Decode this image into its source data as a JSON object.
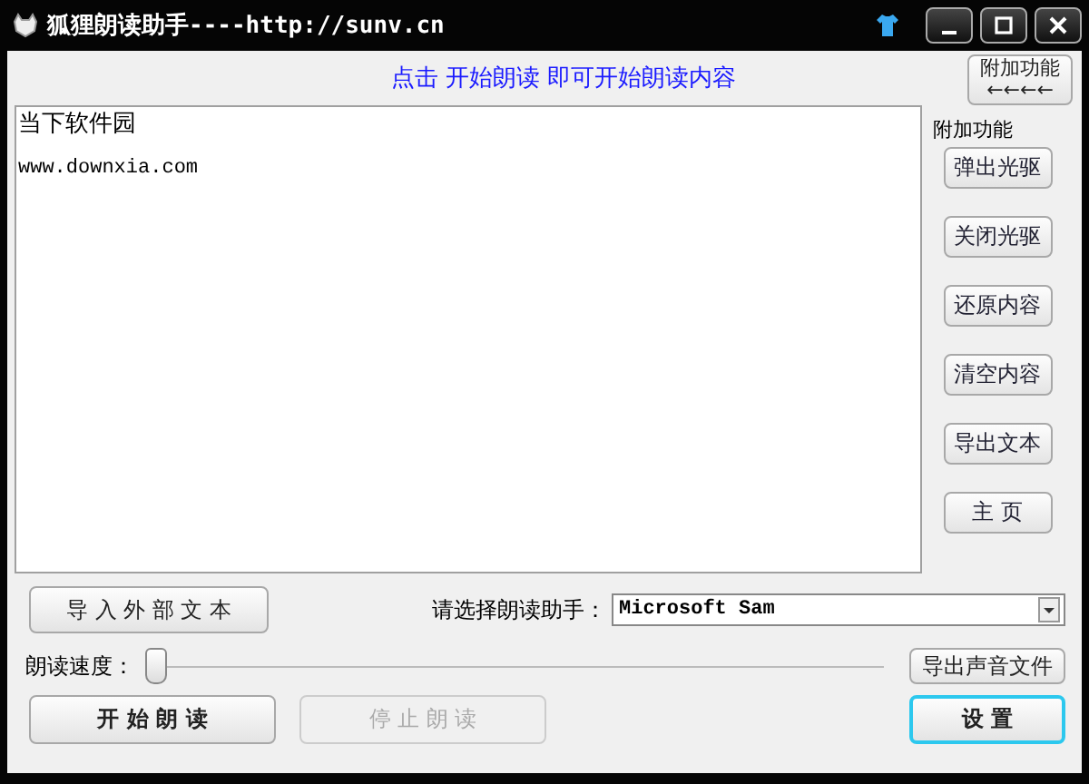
{
  "window": {
    "title": "狐狸朗读助手----http://sunv.cn"
  },
  "instruction": "点击 开始朗读 即可开始朗读内容",
  "extra_toggle": {
    "label": "附加功能",
    "arrows": "←←←←"
  },
  "editor": {
    "lines": [
      "当下软件园",
      "www.downxia.com"
    ]
  },
  "extra_panel": {
    "title": "附加功能",
    "buttons": [
      {
        "label": "弹出光驱"
      },
      {
        "label": "关闭光驱"
      },
      {
        "label": "还原内容"
      },
      {
        "label": "清空内容"
      },
      {
        "label": "导出文本"
      },
      {
        "label": "主  页"
      }
    ]
  },
  "import_button": {
    "label": "导 入 外 部 文 本"
  },
  "voice": {
    "label": "请选择朗读助手：",
    "value": "Microsoft Sam"
  },
  "speed": {
    "label": "朗读速度：",
    "level": 0
  },
  "export_sound_button": {
    "label": "导出声音文件"
  },
  "actions": [
    {
      "label": "开 始 朗 读",
      "disabled": false
    },
    {
      "label": "停 止 朗 读",
      "disabled": true
    }
  ],
  "settings_button": {
    "label": "设  置",
    "focused": true
  }
}
